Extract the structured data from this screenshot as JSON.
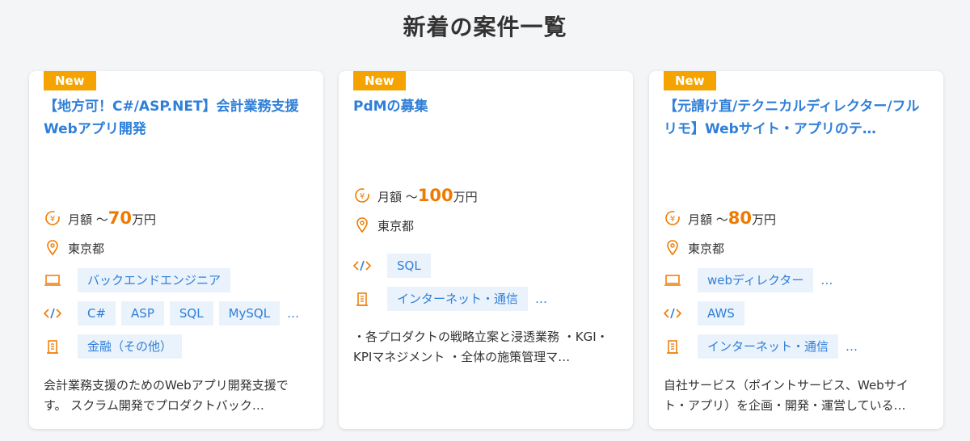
{
  "section_title": "新着の案件一覧",
  "badge": "New",
  "cards": [
    {
      "title": "【地方可！C#/ASP.NET】会計業務支援Webアプリ開発",
      "price_prefix": "月額 〜",
      "price_num": "70",
      "price_unit": "万円",
      "location": "東京都",
      "job_tags": [
        "バックエンドエンジニア"
      ],
      "skill_tags": [
        "C#",
        "ASP",
        "SQL",
        "MySQL"
      ],
      "skill_more": "…",
      "industry_tags": [
        "金融（その他）"
      ],
      "description": "会計業務支援のためのWebアプリ開発支援です。 スクラム開発でプロダクトバック…"
    },
    {
      "title": "PdMの募集",
      "price_prefix": "月額 〜",
      "price_num": "100",
      "price_unit": "万円",
      "location": "東京都",
      "skill_tags": [
        "SQL"
      ],
      "industry_tags": [
        "インターネット・通信"
      ],
      "industry_more": "…",
      "description": "・各プロダクトの戦略立案と浸透業務 ・KGI・KPIマネジメント ・全体の施策管理マ…"
    },
    {
      "title": "【元請け直/テクニカルディレクター/フルリモ】Webサイト・アプリのテ…",
      "price_prefix": "月額 〜",
      "price_num": "80",
      "price_unit": "万円",
      "location": "東京都",
      "job_tags": [
        "webディレクター"
      ],
      "job_more": "…",
      "skill_tags": [
        "AWS"
      ],
      "industry_tags": [
        "インターネット・通信"
      ],
      "industry_more": "…",
      "description": "自社サービス（ポイントサービス、Webサイト・アプリ）を企画・開発・運営している…"
    }
  ]
}
